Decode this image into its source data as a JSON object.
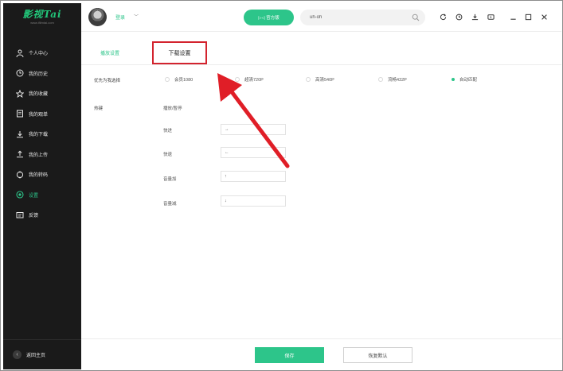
{
  "app": {
    "logo_text": "影视Tai",
    "logo_site": "www.ifilmtai.com",
    "accent_color": "#2dc58a",
    "sidebar_color": "#1a1a1a"
  },
  "sidebar": {
    "items": [
      {
        "label": "个人中心",
        "icon": "person-icon"
      },
      {
        "label": "我的历史",
        "icon": "clock-icon"
      },
      {
        "label": "我的收藏",
        "icon": "star-icon"
      },
      {
        "label": "我的观单",
        "icon": "list-icon"
      },
      {
        "label": "我的下载",
        "icon": "download-icon"
      },
      {
        "label": "我的上传",
        "icon": "upload-icon"
      },
      {
        "label": "我的转码",
        "icon": "convert-icon"
      },
      {
        "label": "设置",
        "icon": "gear-icon",
        "active": true
      },
      {
        "label": "反馈",
        "icon": "feedback-icon"
      }
    ],
    "back_home": "返回主页"
  },
  "header": {
    "login_label": "登录",
    "official_button": "▷◁ 官方版",
    "search_value": "uh-oh"
  },
  "tabs": {
    "play_settings": "播放设置",
    "download_settings": "下载设置"
  },
  "content": {
    "priority_label": "优先为我选择",
    "quality_options": [
      {
        "label": "会员1080",
        "checked": false
      },
      {
        "label": "超清720P",
        "checked": false
      },
      {
        "label": "高清540P",
        "checked": false
      },
      {
        "label": "流畅432P",
        "checked": false
      },
      {
        "label": "自动匹配",
        "checked": true
      }
    ],
    "hotkey_label": "热键",
    "hotkeys": [
      {
        "label": "播放/暂停",
        "value": ""
      },
      {
        "label": "快进",
        "value": "→"
      },
      {
        "label": "快退",
        "value": "←"
      },
      {
        "label": "音量加",
        "value": "↑"
      },
      {
        "label": "音量减",
        "value": "↓"
      }
    ]
  },
  "footer": {
    "save_label": "保存",
    "reset_label": "恢复默认"
  },
  "annotation": {
    "highlight_color": "#d3232e"
  }
}
